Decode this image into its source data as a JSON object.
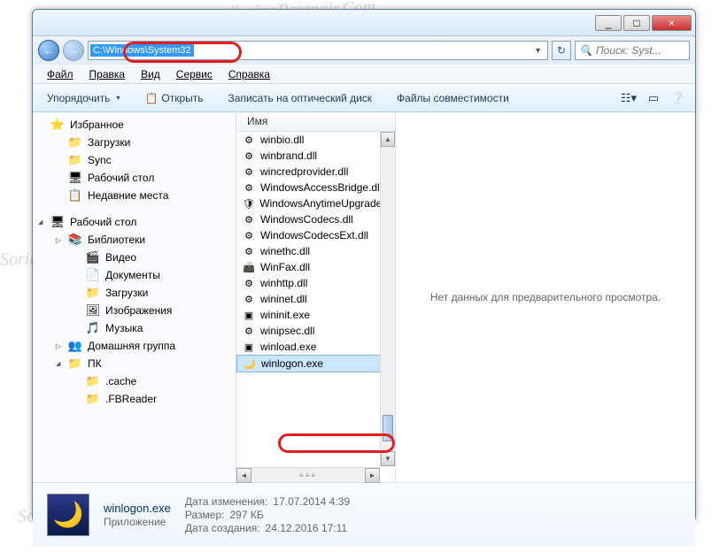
{
  "titlebar": {
    "min": "_",
    "max": "□",
    "close": "×"
  },
  "nav": {
    "back": "←",
    "fwd": "→",
    "address": "C:\\Windows\\System32",
    "refresh": "↻",
    "search_placeholder": "Поиск: Syst..."
  },
  "menu": {
    "file": "Файл",
    "edit": "Правка",
    "view": "Вид",
    "tools": "Сервис",
    "help": "Справка"
  },
  "toolbar": {
    "organize": "Упорядочить",
    "open": "Открыть",
    "burn": "Записать на оптический диск",
    "compat": "Файлы совместимости"
  },
  "sidebar": {
    "fav": "Избранное",
    "downloads": "Загрузки",
    "sync": "Sync",
    "desktop": "Рабочий стол",
    "recent": "Недавние места",
    "desktop2": "Рабочий стол",
    "libs": "Библиотеки",
    "video": "Видео",
    "docs": "Документы",
    "downloads2": "Загрузки",
    "pics": "Изображения",
    "music": "Музыка",
    "homegroup": "Домашняя группа",
    "pc": "ПК",
    "cache": ".cache",
    "fbr": ".FBReader"
  },
  "col": {
    "name": "Имя"
  },
  "files": [
    {
      "icon": "⚙",
      "n": "winbio.dll"
    },
    {
      "icon": "⚙",
      "n": "winbrand.dll"
    },
    {
      "icon": "⚙",
      "n": "wincredprovider.dll"
    },
    {
      "icon": "⚙",
      "n": "WindowsAccessBridge.dll"
    },
    {
      "icon": "🛡",
      "n": "WindowsAnytimeUpgradeR"
    },
    {
      "icon": "⚙",
      "n": "WindowsCodecs.dll"
    },
    {
      "icon": "⚙",
      "n": "WindowsCodecsExt.dll"
    },
    {
      "icon": "⚙",
      "n": "winethc.dll"
    },
    {
      "icon": "📠",
      "n": "WinFax.dll"
    },
    {
      "icon": "⚙",
      "n": "winhttp.dll"
    },
    {
      "icon": "⚙",
      "n": "wininet.dll"
    },
    {
      "icon": "▣",
      "n": "wininit.exe"
    },
    {
      "icon": "⚙",
      "n": "winipsec.dll"
    },
    {
      "icon": "▣",
      "n": "winload.exe"
    },
    {
      "icon": "🌙",
      "n": "winlogon.exe",
      "sel": true
    }
  ],
  "preview": {
    "text": "Нет данных для предварительного просмотра."
  },
  "details": {
    "name": "winlogon.exe",
    "type": "Приложение",
    "mod_lbl": "Дата изменения:",
    "mod": "17.07.2014 4:39",
    "size_lbl": "Размер:",
    "size": "297 КБ",
    "created_lbl": "Дата создания:",
    "created": "24.12.2016 17:11"
  },
  "watermark": "SoringPcrepair.Com"
}
